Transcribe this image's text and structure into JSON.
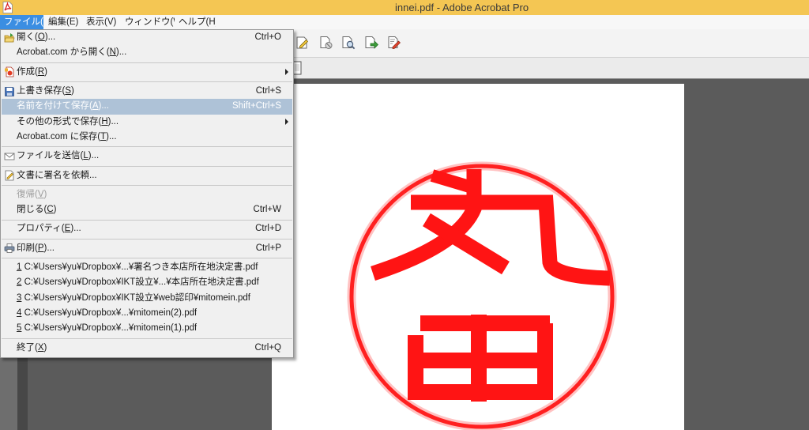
{
  "window": {
    "title": "innei.pdf - Adobe Acrobat Pro",
    "app_icon": "acrobat-app-icon"
  },
  "menubar": {
    "items": [
      {
        "label": "ファイル(F)",
        "active": true
      },
      {
        "label": "編集(E)"
      },
      {
        "label": "表示(V)"
      },
      {
        "label": "ウィンドウ(W)"
      },
      {
        "label": "ヘルプ(H)"
      }
    ]
  },
  "toolbar": {
    "icons": [
      "fill-sign-icon",
      "document-blocked-icon",
      "document-inspect-icon",
      "document-export-icon",
      "document-edit-icon"
    ],
    "secondary_icons": [
      "page-thumbnail-icon"
    ]
  },
  "file_menu": {
    "items": [
      {
        "label": "開く(O)...",
        "shortcut": "Ctrl+O",
        "icon": "open-folder-icon"
      },
      {
        "label": "Acrobat.com から開く(N)..."
      },
      {
        "label": "作成(R)",
        "icon": "create-pdf-icon",
        "submenu": true
      },
      {
        "label": "上書き保存(S)",
        "shortcut": "Ctrl+S",
        "icon": "save-icon"
      },
      {
        "label": "名前を付けて保存(A)...",
        "shortcut": "Shift+Ctrl+S",
        "state": "hover"
      },
      {
        "label": "その他の形式で保存(H)...",
        "submenu": true
      },
      {
        "label": "Acrobat.com に保存(T)..."
      },
      {
        "label": "ファイルを送信(L)...",
        "icon": "envelope-icon"
      },
      {
        "label": "文書に署名を依頼...",
        "icon": "sign-request-icon"
      },
      {
        "label": "復帰(V)",
        "state": "disabled"
      },
      {
        "label": "閉じる(C)",
        "shortcut": "Ctrl+W"
      },
      {
        "label": "プロパティ(E)...",
        "shortcut": "Ctrl+D"
      },
      {
        "label": "印刷(P)...",
        "shortcut": "Ctrl+P",
        "icon": "printer-icon"
      },
      {
        "label": "1 C:¥Users¥yu¥Dropbox¥...¥署名つき本店所在地決定書.pdf"
      },
      {
        "label": "2 C:¥Users¥yu¥Dropbox¥IKT設立¥...¥本店所在地決定書.pdf"
      },
      {
        "label": "3 C:¥Users¥yu¥Dropbox¥IKT設立¥web認印¥mitomein.pdf"
      },
      {
        "label": "4 C:¥Users¥yu¥Dropbox¥...¥mitomein(2).pdf"
      },
      {
        "label": "5 C:¥Users¥yu¥Dropbox¥...¥mitomein(1).pdf"
      },
      {
        "label": "終了(X)",
        "shortcut": "Ctrl+Q"
      }
    ]
  },
  "document": {
    "seal": {
      "characters": "丸田",
      "color": "#ff2020"
    }
  },
  "colors": {
    "title_bar": "#f4c653",
    "menu_active": "#3b8ee2",
    "menu_hover": "#aec2d7",
    "document_background": "#5b5b5b"
  }
}
